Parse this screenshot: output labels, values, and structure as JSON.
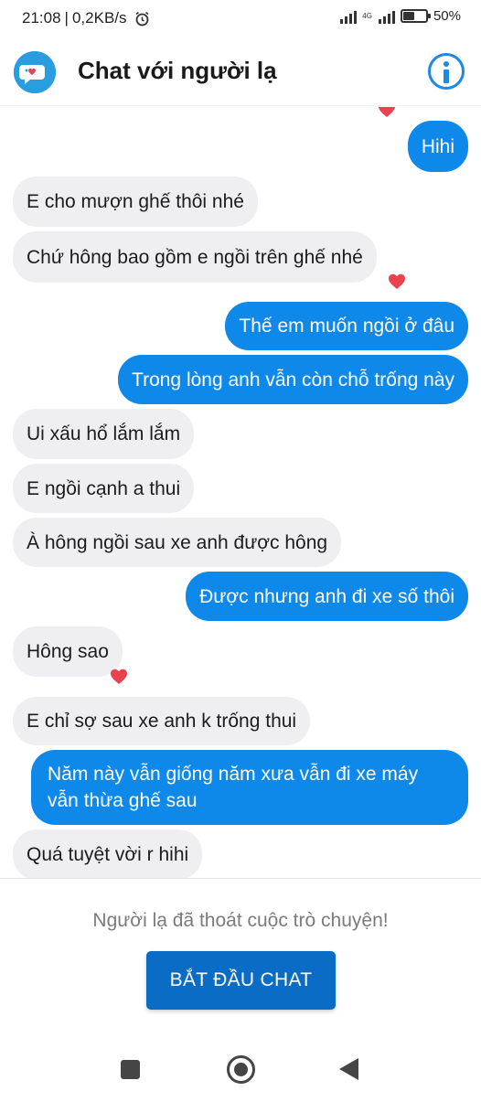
{
  "status_bar": {
    "time": "21:08",
    "speed": "0,2KB/s",
    "network": "4G",
    "battery": "50%",
    "battery_level": 0.5
  },
  "header": {
    "title": "Chat với người lạ",
    "logo_icon": "chat-bubble-heart-icon",
    "info_icon": "info-icon"
  },
  "colors": {
    "accent": "#0e89ea",
    "incoming_bg": "#efeff1",
    "button": "#0a6cc4",
    "heart": "#e8434f"
  },
  "messages": [
    {
      "dir": "out",
      "text": "Hihi"
    },
    {
      "dir": "in",
      "text": "E cho mượn ghế thôi nhé"
    },
    {
      "dir": "in",
      "text": "Chứ hông bao gồm e ngồi trên ghế nhé",
      "reaction": "heart"
    },
    {
      "dir": "out",
      "text": "Thế em muốn ngồi ở đâu"
    },
    {
      "dir": "out",
      "text": "Trong lòng anh vẫn còn chỗ trống này"
    },
    {
      "dir": "in",
      "text": "Ui xấu hổ lắm lắm"
    },
    {
      "dir": "in",
      "text": "E ngồi cạnh a thui"
    },
    {
      "dir": "in",
      "text": "À hông ngồi sau xe anh được hông"
    },
    {
      "dir": "out",
      "text": "Được nhưng anh đi xe số thôi"
    },
    {
      "dir": "in",
      "text": "Hông sao",
      "reaction": "heart"
    },
    {
      "dir": "in",
      "text": "E chỉ sợ sau xe anh k trống thui"
    },
    {
      "dir": "out",
      "text": "Năm này vẫn giống năm xưa vẫn đi xe máy vẫn thừa ghế sau"
    },
    {
      "dir": "in",
      "text": "Quá tuyệt vời r hihi"
    }
  ],
  "footer": {
    "ended_text": "Người lạ đã thoát cuộc trò chuyện!",
    "start_button": "BẮT ĐẦU CHAT"
  }
}
